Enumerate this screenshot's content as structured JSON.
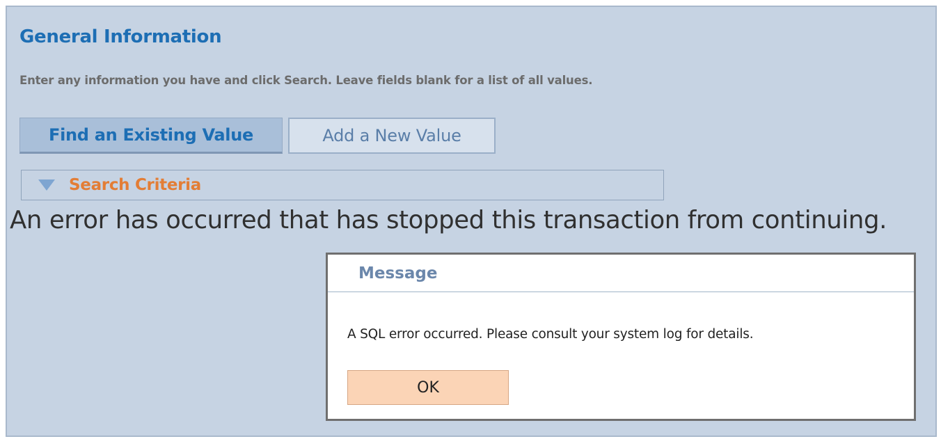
{
  "page": {
    "title": "General Information",
    "instructions": "Enter any information you have and click Search. Leave fields blank for a list of all values."
  },
  "tabs": [
    {
      "label": "Find an Existing Value",
      "active": true
    },
    {
      "label": "Add a New Value",
      "active": false
    }
  ],
  "search_section": {
    "label": "Search Criteria",
    "icon": "expand-triangle-icon"
  },
  "error": {
    "text": "An error has occurred that has stopped this transaction from continuing."
  },
  "dialog": {
    "title": "Message",
    "message": "A SQL error occurred. Please consult your system log for details.",
    "ok_label": "OK"
  },
  "colors": {
    "title": "#1d6eb4",
    "panel_background": "#c6d3e3",
    "section_label": "#e37d35",
    "ok_button": "#fbd4b6"
  }
}
